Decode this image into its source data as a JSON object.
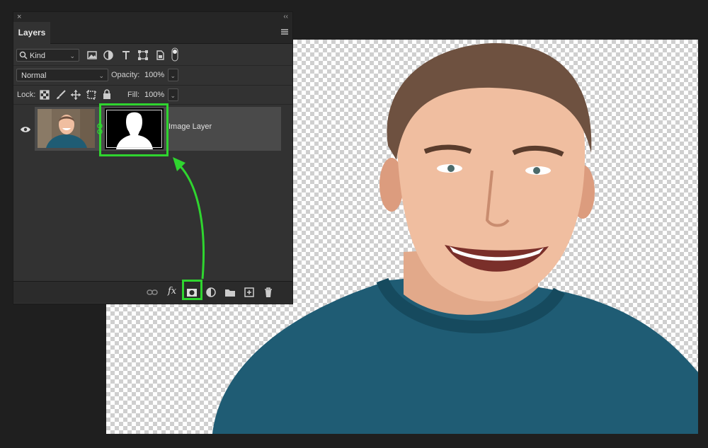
{
  "panel": {
    "close_glyph": "×",
    "collapse_glyph": "‹‹",
    "tab_label": "Layers",
    "filter": {
      "kind_label": "Kind"
    },
    "blend_mode": "Normal",
    "opacity_label": "Opacity:",
    "opacity_value": "100%",
    "lock_label": "Lock:",
    "fill_label": "Fill:",
    "fill_value": "100%",
    "fx_label": "fx",
    "layer": {
      "name": "Image Layer",
      "visible": true
    }
  },
  "accent_color": "#2fd52f",
  "icons": [
    "close-icon",
    "collapse-icon",
    "panel-menu-icon",
    "search-icon",
    "image-filter-icon",
    "adjustment-filter-icon",
    "type-filter-icon",
    "shape-filter-icon",
    "smart-object-filter-icon",
    "filter-toggle-icon",
    "lock-transparent-icon",
    "lock-paint-icon",
    "lock-position-icon",
    "lock-artboard-icon",
    "lock-all-icon",
    "eye-icon",
    "link-icon",
    "fx-icon",
    "add-mask-icon",
    "adjustment-layer-icon",
    "folder-icon",
    "new-layer-icon",
    "trash-icon"
  ]
}
